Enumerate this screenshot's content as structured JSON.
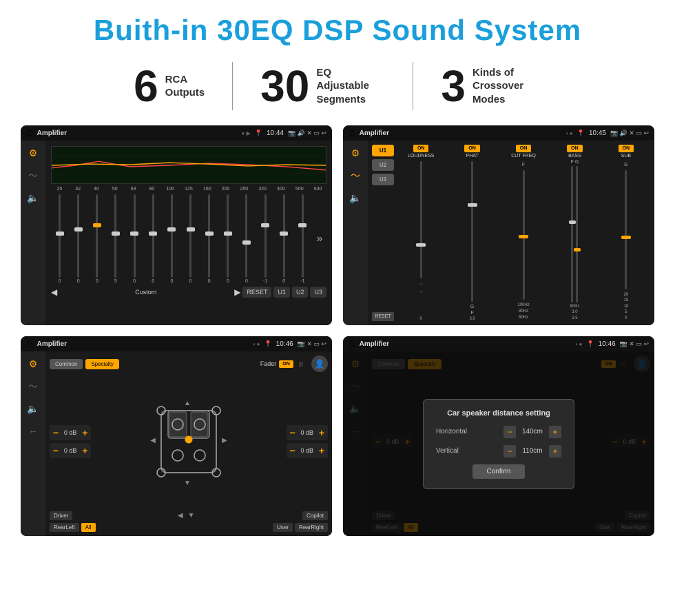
{
  "title": "Buith-in 30EQ DSP Sound System",
  "stats": [
    {
      "number": "6",
      "desc": "RCA\nOutputs"
    },
    {
      "number": "30",
      "desc": "EQ Adjustable\nSegments"
    },
    {
      "number": "3",
      "desc": "Kinds of\nCrossover Modes"
    }
  ],
  "screens": [
    {
      "id": "screen1",
      "topbar": {
        "title": "Amplifier",
        "time": "10:44"
      },
      "type": "eq",
      "freqs": [
        "25",
        "32",
        "40",
        "50",
        "63",
        "80",
        "100",
        "125",
        "160",
        "200",
        "250",
        "320",
        "400",
        "500",
        "630"
      ],
      "values": [
        "0",
        "0",
        "0",
        "5",
        "0",
        "0",
        "0",
        "0",
        "0",
        "0",
        "0",
        "-1",
        "0",
        "-1"
      ],
      "preset": "Custom",
      "buttons": [
        "RESET",
        "U1",
        "U2",
        "U3"
      ]
    },
    {
      "id": "screen2",
      "topbar": {
        "title": "Amplifier",
        "time": "10:45"
      },
      "type": "crossover",
      "presets": [
        "U1",
        "U2",
        "U3"
      ],
      "channels": [
        "LOUDNESS",
        "PHAT",
        "CUT FREQ",
        "BASS",
        "SUB"
      ],
      "toggles": [
        "ON",
        "ON",
        "ON",
        "ON",
        "ON"
      ]
    },
    {
      "id": "screen3",
      "topbar": {
        "title": "Amplifier",
        "time": "10:46"
      },
      "type": "fader",
      "modes": [
        "Common",
        "Specialty"
      ],
      "faderLabel": "Fader",
      "faderOn": "ON",
      "volumes": [
        "0 dB",
        "0 dB",
        "0 dB",
        "0 dB"
      ],
      "zones": [
        "Driver",
        "Copilot",
        "RearLeft",
        "All",
        "User",
        "RearRight"
      ]
    },
    {
      "id": "screen4",
      "topbar": {
        "title": "Amplifier",
        "time": "10:46"
      },
      "type": "dialog",
      "modes": [
        "Common",
        "Specialty"
      ],
      "dialog": {
        "title": "Car speaker distance setting",
        "horizontal_label": "Horizontal",
        "horizontal_value": "140cm",
        "vertical_label": "Vertical",
        "vertical_value": "110cm",
        "confirm_label": "Confirm"
      },
      "volumes": [
        "0 dB",
        "0 dB"
      ],
      "zones": [
        "Driver",
        "Copilot",
        "RearLeft",
        "User",
        "RearRight"
      ]
    }
  ],
  "icons": {
    "home": "⌂",
    "location": "📍",
    "volume": "🔊",
    "back": "↩",
    "eq1": "≈",
    "eq2": "〜",
    "speaker": "🔈"
  }
}
